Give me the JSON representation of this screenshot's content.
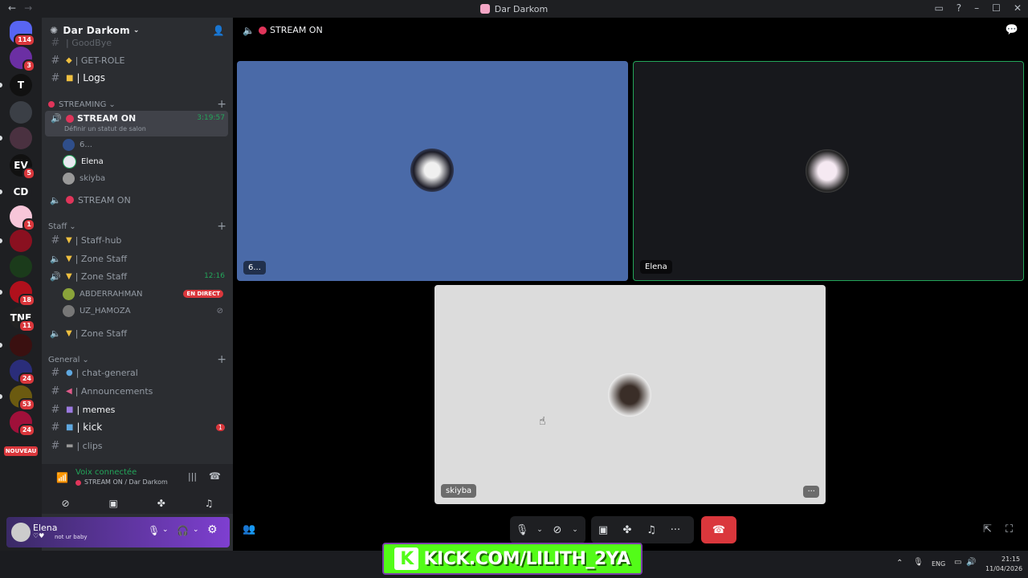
{
  "window": {
    "title": "Dar Darkom"
  },
  "guilds": [
    {
      "label": "",
      "badge": "114",
      "color": "#5865f2",
      "icon": "discord-logo-icon"
    },
    {
      "label": "",
      "badge": "3",
      "color": "#6b2fa3",
      "icon": "server-icon"
    },
    {
      "label": "T",
      "badge": "",
      "color": "#111",
      "icon": "server-icon"
    },
    {
      "label": "",
      "badge": "",
      "color": "#3b3f46",
      "icon": "server-icon"
    },
    {
      "label": "",
      "badge": "",
      "color": "#4a3140",
      "icon": "server-icon"
    },
    {
      "label": "EV",
      "badge": "5",
      "color": "#111",
      "icon": "server-icon"
    },
    {
      "label": "CD",
      "badge": "",
      "color": "#1e1f22",
      "icon": "server-icon"
    },
    {
      "label": "",
      "badge": "1",
      "color": "#f7c6d9",
      "icon": "server-icon"
    },
    {
      "label": "",
      "badge": "",
      "color": "#8a1020",
      "icon": "server-icon"
    },
    {
      "label": "",
      "badge": "",
      "color": "#1b3b1b",
      "icon": "server-icon"
    },
    {
      "label": "",
      "badge": "18",
      "color": "#b0101c",
      "icon": "server-icon"
    },
    {
      "label": "TNE",
      "badge": "11",
      "color": "#222",
      "icon": "server-icon"
    },
    {
      "label": "",
      "badge": "",
      "color": "#3a1010",
      "icon": "server-icon"
    },
    {
      "label": "",
      "badge": "24",
      "color": "#2a2d7a",
      "icon": "server-icon"
    },
    {
      "label": "",
      "badge": "53",
      "color": "#6b5a10",
      "icon": "server-icon"
    },
    {
      "label": "",
      "badge": "24",
      "color": "#a0103a",
      "icon": "server-icon"
    }
  ],
  "guilds_new_label": "NOUVEAU",
  "server": {
    "name": "Dar Darkom"
  },
  "channels": {
    "top_partial": "| GoodBye",
    "get_role": "| GET-ROLE",
    "logs": "| Logs",
    "cat_streaming": "STREAMING",
    "stream_on_active": "STREAM ON",
    "stream_on_time": "3:19:57",
    "stream_on_status": "Définir un statut de salon",
    "voice_users_1": [
      {
        "name": "6...",
        "color": "#2f4e8a"
      },
      {
        "name": "Elena",
        "color": "#e8e8f0"
      },
      {
        "name": "skiyba",
        "color": "#999"
      }
    ],
    "stream_on_2": "STREAM ON",
    "cat_staff": "Staff",
    "staff_hub": "| Staff-hub",
    "zone_staff_1": "| Zone Staff",
    "zone_staff_2": "| Zone Staff",
    "zone_staff_2_time": "12:16",
    "staff_users": [
      {
        "name": "ABDERRAHMAN",
        "badge": "EN DIRECT"
      },
      {
        "name": "UZ_HAMOZA",
        "badge": ""
      }
    ],
    "zone_staff_3": "| Zone Staff",
    "cat_general": "General",
    "chat_general": "| chat-general",
    "announcements": "| Announcements",
    "memes": "| memes",
    "kick": "| kick",
    "kick_badge": "1",
    "clips": "| clips"
  },
  "voice_panel": {
    "status": "Voix connectée",
    "location": "STREAM ON / Dar Darkom"
  },
  "user_panel": {
    "name": "Elena",
    "status": "not ur baby"
  },
  "main": {
    "channel_title": "STREAM ON",
    "tiles": [
      {
        "label": "6...",
        "bg": "#4a6aa8"
      },
      {
        "label": "Elena",
        "bg": "#17181c"
      },
      {
        "label": "skiyba",
        "bg": "#dcdcdc"
      }
    ]
  },
  "overlay": {
    "kick_text": "KICK.COM/LILITH_2YA"
  },
  "taskbar": {
    "lang": "ENG",
    "time": "21:15",
    "date": "11/04/2026"
  }
}
